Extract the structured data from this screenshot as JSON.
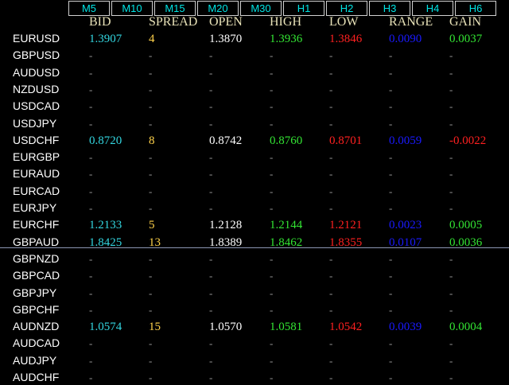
{
  "tabs": [
    "M5",
    "M10",
    "M15",
    "M20",
    "M30",
    "H1",
    "H2",
    "H3",
    "H4",
    "H6"
  ],
  "headers": [
    "BID",
    "SPREAD",
    "OPEN",
    "HIGH",
    "LOW",
    "RANGE",
    "GAIN"
  ],
  "colors": {
    "bid": "#33d6e0",
    "spread": "#ffd24a",
    "open": "#ffffff",
    "high": "#33e433",
    "low": "#ff2020",
    "range": "#1a1aff",
    "gain_pos": "#33e433",
    "gain_neg": "#ff2020",
    "dash": "#9a9a9a",
    "header": "#e8e2b8"
  },
  "rows": [
    {
      "symbol": "EURUSD",
      "bid": "1.3907",
      "spread": "4",
      "open": "1.3870",
      "high": "1.3936",
      "low": "1.3846",
      "range": "0.0090",
      "gain": "0.0037"
    },
    {
      "symbol": "GBPUSD",
      "bid": "-",
      "spread": "-",
      "open": "-",
      "high": "-",
      "low": "-",
      "range": "-",
      "gain": "-"
    },
    {
      "symbol": "AUDUSD",
      "bid": "-",
      "spread": "-",
      "open": "-",
      "high": "-",
      "low": "-",
      "range": "-",
      "gain": "-"
    },
    {
      "symbol": "NZDUSD",
      "bid": "-",
      "spread": "-",
      "open": "-",
      "high": "-",
      "low": "-",
      "range": "-",
      "gain": "-"
    },
    {
      "symbol": "USDCAD",
      "bid": "-",
      "spread": "-",
      "open": "-",
      "high": "-",
      "low": "-",
      "range": "-",
      "gain": "-"
    },
    {
      "symbol": "USDJPY",
      "bid": "-",
      "spread": "-",
      "open": "-",
      "high": "-",
      "low": "-",
      "range": "-",
      "gain": "-"
    },
    {
      "symbol": "USDCHF",
      "bid": "0.8720",
      "spread": "8",
      "open": "0.8742",
      "high": "0.8760",
      "low": "0.8701",
      "range": "0.0059",
      "gain": "-0.0022"
    },
    {
      "symbol": "EURGBP",
      "bid": "-",
      "spread": "-",
      "open": "-",
      "high": "-",
      "low": "-",
      "range": "-",
      "gain": "-"
    },
    {
      "symbol": "EURAUD",
      "bid": "-",
      "spread": "-",
      "open": "-",
      "high": "-",
      "low": "-",
      "range": "-",
      "gain": "-"
    },
    {
      "symbol": "EURCAD",
      "bid": "-",
      "spread": "-",
      "open": "-",
      "high": "-",
      "low": "-",
      "range": "-",
      "gain": "-"
    },
    {
      "symbol": "EURJPY",
      "bid": "-",
      "spread": "-",
      "open": "-",
      "high": "-",
      "low": "-",
      "range": "-",
      "gain": "-"
    },
    {
      "symbol": "EURCHF",
      "bid": "1.2133",
      "spread": "5",
      "open": "1.2128",
      "high": "1.2144",
      "low": "1.2121",
      "range": "0.0023",
      "gain": "0.0005"
    },
    {
      "symbol": "GBPAUD",
      "bid": "1.8425",
      "spread": "13",
      "open": "1.8389",
      "high": "1.8462",
      "low": "1.8355",
      "range": "0.0107",
      "gain": "0.0036"
    },
    {
      "symbol": "GBPNZD",
      "bid": "-",
      "spread": "-",
      "open": "-",
      "high": "-",
      "low": "-",
      "range": "-",
      "gain": "-"
    },
    {
      "symbol": "GBPCAD",
      "bid": "-",
      "spread": "-",
      "open": "-",
      "high": "-",
      "low": "-",
      "range": "-",
      "gain": "-"
    },
    {
      "symbol": "GBPJPY",
      "bid": "-",
      "spread": "-",
      "open": "-",
      "high": "-",
      "low": "-",
      "range": "-",
      "gain": "-"
    },
    {
      "symbol": "GBPCHF",
      "bid": "-",
      "spread": "-",
      "open": "-",
      "high": "-",
      "low": "-",
      "range": "-",
      "gain": "-"
    },
    {
      "symbol": "AUDNZD",
      "bid": "1.0574",
      "spread": "15",
      "open": "1.0570",
      "high": "1.0581",
      "low": "1.0542",
      "range": "0.0039",
      "gain": "0.0004"
    },
    {
      "symbol": "AUDCAD",
      "bid": "-",
      "spread": "-",
      "open": "-",
      "high": "-",
      "low": "-",
      "range": "-",
      "gain": "-"
    },
    {
      "symbol": "AUDJPY",
      "bid": "-",
      "spread": "-",
      "open": "-",
      "high": "-",
      "low": "-",
      "range": "-",
      "gain": "-"
    },
    {
      "symbol": "AUDCHF",
      "bid": "-",
      "spread": "-",
      "open": "-",
      "high": "-",
      "low": "-",
      "range": "-",
      "gain": "-"
    }
  ]
}
